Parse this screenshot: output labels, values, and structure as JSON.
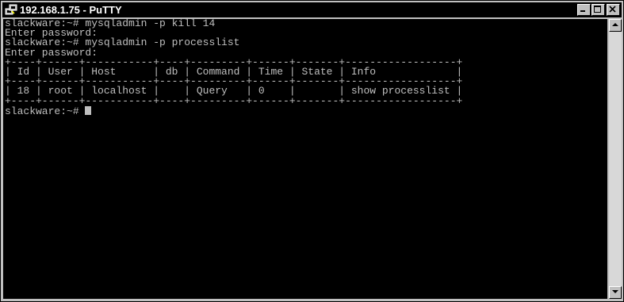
{
  "window": {
    "title": "192.168.1.75 - PuTTY"
  },
  "caption_buttons": [
    "minimize-icon",
    "maximize-icon",
    "close-icon"
  ],
  "terminal": {
    "lines": [
      "slackware:~# mysqladmin -p kill 14",
      "Enter password:",
      "slackware:~# mysqladmin -p processlist",
      "Enter password:",
      "+----+------+-----------+----+---------+------+-------+------------------+",
      "| Id | User | Host      | db | Command | Time | State | Info             |",
      "+----+------+-----------+----+---------+------+-------+------------------+",
      "| 18 | root | localhost |    | Query   | 0    |       | show processlist |",
      "+----+------+-----------+----+---------+------+-------+------------------+"
    ],
    "prompt": "slackware:~# "
  },
  "colors": {
    "terminal_bg": "#000000",
    "terminal_fg": "#bfbfbf",
    "titlebar_bg": "#000000"
  }
}
